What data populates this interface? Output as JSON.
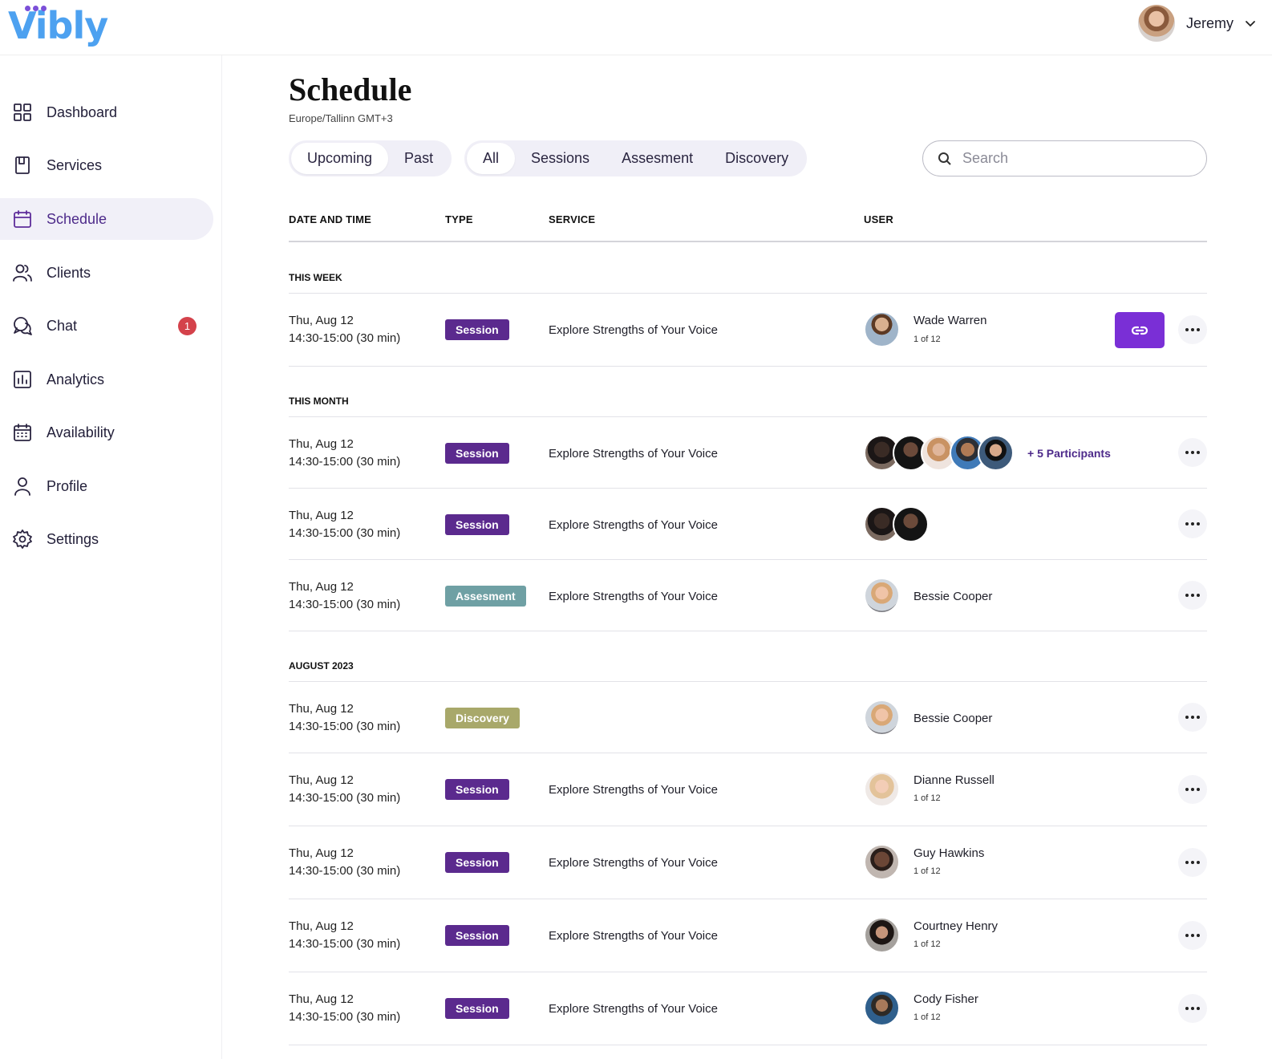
{
  "app": {
    "logo": "Vibly"
  },
  "user": {
    "name": "Jeremy"
  },
  "sidebar": {
    "items": [
      {
        "label": "Dashboard",
        "icon": "grid-icon"
      },
      {
        "label": "Services",
        "icon": "book-icon"
      },
      {
        "label": "Schedule",
        "icon": "calendar-icon",
        "active": true
      },
      {
        "label": "Clients",
        "icon": "users-icon"
      },
      {
        "label": "Chat",
        "icon": "chat-icon",
        "badge": "1"
      },
      {
        "label": "Analytics",
        "icon": "bar-chart-icon"
      },
      {
        "label": "Availability",
        "icon": "calendar-grid-icon"
      },
      {
        "label": "Profile",
        "icon": "user-icon"
      },
      {
        "label": "Settings",
        "icon": "gear-icon"
      }
    ]
  },
  "page": {
    "title": "Schedule",
    "timezone": "Europe/Tallinn GMT+3",
    "time_filter": [
      "Upcoming",
      "Past"
    ],
    "type_filter": [
      "All",
      "Sessions",
      "Assesment",
      "Discovery"
    ],
    "search_placeholder": "Search"
  },
  "table": {
    "headers": [
      "DATE AND TIME",
      "TYPE",
      "SERVICE",
      "USER"
    ],
    "groups": [
      "THIS WEEK",
      "THIS MONTH",
      "AUGUST 2023"
    ],
    "rows": [
      {
        "date": "Thu, Aug 12",
        "time": "14:30-15:00 (30 min)",
        "type": "Session",
        "service": "Explore Strengths of Your Voice",
        "user": "Wade Warren",
        "sub": "1 of 12"
      },
      {
        "date": "Thu, Aug 12",
        "time": "14:30-15:00 (30 min)",
        "type": "Session",
        "service": "Explore Strengths of Your Voice",
        "participants": "+ 5 Participants"
      },
      {
        "date": "Thu, Aug 12",
        "time": "14:30-15:00 (30 min)",
        "type": "Session",
        "service": "Explore Strengths of Your Voice"
      },
      {
        "date": "Thu, Aug 12",
        "time": "14:30-15:00 (30 min)",
        "type": "Assesment",
        "service": "Explore Strengths of Your Voice",
        "user": "Bessie Cooper"
      },
      {
        "date": "Thu, Aug 12",
        "time": "14:30-15:00 (30 min)",
        "type": "Discovery",
        "service": "",
        "user": "Bessie Cooper"
      },
      {
        "date": "Thu, Aug 12",
        "time": "14:30-15:00 (30 min)",
        "type": "Session",
        "service": "Explore Strengths of Your Voice",
        "user": "Dianne Russell",
        "sub": "1 of 12"
      },
      {
        "date": "Thu, Aug 12",
        "time": "14:30-15:00 (30 min)",
        "type": "Session",
        "service": "Explore Strengths of Your Voice",
        "user": "Guy Hawkins",
        "sub": "1 of 12"
      },
      {
        "date": "Thu, Aug 12",
        "time": "14:30-15:00 (30 min)",
        "type": "Session",
        "service": "Explore Strengths of Your Voice",
        "user": "Courtney Henry",
        "sub": "1 of 12"
      },
      {
        "date": "Thu, Aug 12",
        "time": "14:30-15:00 (30 min)",
        "type": "Session",
        "service": "Explore Strengths of Your Voice",
        "user": "Cody Fisher",
        "sub": "1 of 12"
      }
    ]
  },
  "colors": {
    "accent": "#5b2a8e",
    "link_button": "#7a2fd6",
    "assesment": "#6fa0a4",
    "discovery": "#a8a86a",
    "badge": "#d4424b",
    "logo": "#4da1f0"
  }
}
